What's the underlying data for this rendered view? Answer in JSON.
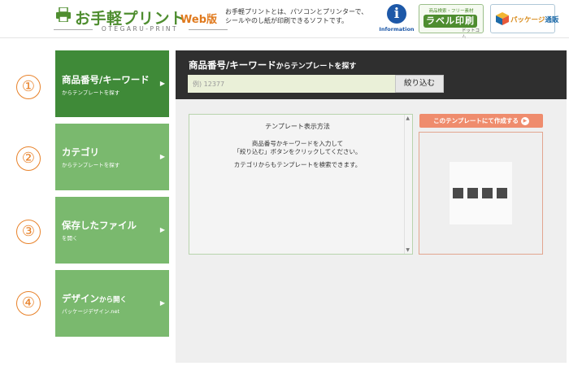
{
  "header": {
    "logo_title": "お手軽プリント",
    "logo_web": "Web版",
    "logo_subtitle": "OTEGARU-PRINT",
    "description_line1": "お手軽プリントとは、パソコンとプリンターで、",
    "description_line2": "シールやのし紙が印刷できるソフトです。",
    "info_icon_char": "i",
    "info_label": "Information",
    "label_small": "商品検索・フリー素材",
    "label_big": "ラベル印刷",
    "label_tag": "ドットコム",
    "pkg_text_1": "パッケージ",
    "pkg_text_2": "通販"
  },
  "side_numbers": [
    "①",
    "②",
    "③",
    "④"
  ],
  "nav": [
    {
      "title": "商品番号/キーワード",
      "title_small": "",
      "subtitle": "からテンプレートを探す",
      "arrow": "▶"
    },
    {
      "title": "カテゴリ",
      "title_small": "",
      "subtitle": "からテンプレートを探す",
      "arrow": "▶"
    },
    {
      "title": "保存したファイル",
      "title_small": "",
      "subtitle": "を開く",
      "arrow": "▶"
    },
    {
      "title": "デザイン",
      "title_small": "から開く",
      "subtitle": "パッケージデザイン.net",
      "arrow": "▶"
    }
  ],
  "search": {
    "title": "商品番号/キーワード",
    "title_small": "からテンプレートを探す",
    "placeholder": "例) 12377",
    "button_label": "絞り込む"
  },
  "instructions": {
    "title": "テンプレート表示方法",
    "line1": "商品番号かキーワードを入力して",
    "line2": "「絞り込む」ボタンをクリックしてください。",
    "line3": "カテゴリからもテンプレートを検索できます。"
  },
  "create_button": {
    "label": "このテンプレートにて作成する",
    "arrow": "▶"
  },
  "colors": {
    "active_nav": "#3f8a38",
    "inactive_nav": "#7ab96e",
    "accent_orange": "#e8822a",
    "create_button": "#ef8c6d",
    "search_bar": "#2f2f2f",
    "info_blue": "#1d58a8"
  }
}
